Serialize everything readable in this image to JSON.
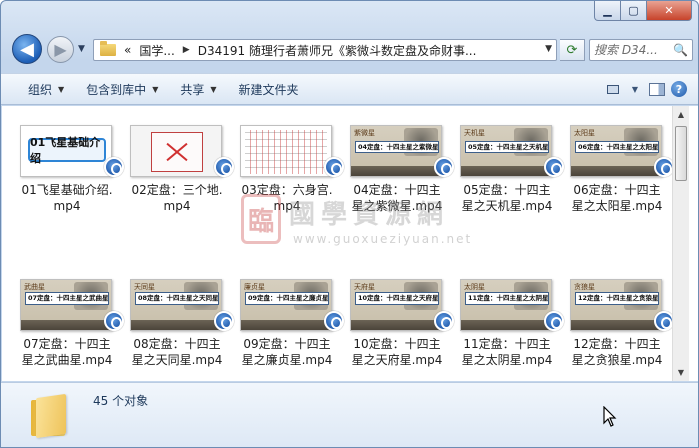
{
  "window": {
    "controls": {
      "minimize": "▁",
      "maximize": "▢",
      "close": "✕"
    }
  },
  "nav": {
    "back_icon": "◀",
    "forward_icon": "▶",
    "recent_icon": "▼",
    "address": {
      "overflow": "«",
      "crumb1": "国学...",
      "sep": "▶",
      "crumb2": "D34191 随理行者萧师兄《紫微斗数定盘及命财事...",
      "dropdown": "▼"
    },
    "refresh_icon": "⟳",
    "search_placeholder": "搜索 D34...",
    "search_icon": "🔍"
  },
  "toolbar": {
    "organize": "组织",
    "include_in_library": "包含到库中",
    "share": "共享",
    "new_folder": "新建文件夹",
    "dropdown_arrow": "▼",
    "view_icon": "view-icon",
    "help": "?"
  },
  "files": [
    {
      "name": "01飞星基础介绍.mp4",
      "line1": "01飞星基础介绍.",
      "line2": "mp4",
      "thumb_title": "01飞星基础介绍"
    },
    {
      "name": "02定盘：三个地.mp4",
      "line1": "02定盘：三个地.",
      "line2": "mp4"
    },
    {
      "name": "03定盘：六身宫.mp4",
      "line1": "03定盘：六身宫.",
      "line2": "mp4"
    },
    {
      "name": "04定盘：十四主星之紫微星.mp4",
      "line1": "04定盘：十四主",
      "line2": "星之紫微星.mp4",
      "thumb_tag": "紫微星",
      "thumb_bar": "04定盘：十四主星之紫微星"
    },
    {
      "name": "05定盘：十四主星之天机星.mp4",
      "line1": "05定盘：十四主",
      "line2": "星之天机星.mp4",
      "thumb_tag": "天机星",
      "thumb_bar": "05定盘：十四主星之天机星"
    },
    {
      "name": "06定盘：十四主星之太阳星.mp4",
      "line1": "06定盘：十四主",
      "line2": "星之太阳星.mp4",
      "thumb_tag": "太阳星",
      "thumb_bar": "06定盘：十四主星之太阳星"
    },
    {
      "name": "07定盘：十四主星之武曲星.mp4",
      "line1": "07定盘：十四主",
      "line2": "星之武曲星.mp4",
      "thumb_tag": "武曲星",
      "thumb_bar": "07定盘：十四主星之武曲星"
    },
    {
      "name": "08定盘：十四主星之天同星.mp4",
      "line1": "08定盘：十四主",
      "line2": "星之天同星.mp4",
      "thumb_tag": "天同星",
      "thumb_bar": "08定盘：十四主星之天同星"
    },
    {
      "name": "09定盘：十四主星之廉贞星.mp4",
      "line1": "09定盘：十四主",
      "line2": "星之廉贞星.mp4",
      "thumb_tag": "廉贞星",
      "thumb_bar": "09定盘：十四主星之廉贞星"
    },
    {
      "name": "10定盘：十四主星之天府星.mp4",
      "line1": "10定盘：十四主",
      "line2": "星之天府星.mp4",
      "thumb_tag": "天府星",
      "thumb_bar": "10定盘：十四主星之天府星"
    },
    {
      "name": "11定盘：十四主星之太阴星.mp4",
      "line1": "11定盘：十四主",
      "line2": "星之太阴星.mp4",
      "thumb_tag": "太阴星",
      "thumb_bar": "11定盘：十四主星之太阴星"
    },
    {
      "name": "12定盘：十四主星之贪狼星.mp4",
      "line1": "12定盘：十四主",
      "line2": "星之贪狼星.mp4",
      "thumb_tag": "贪狼星",
      "thumb_bar": "12定盘：十四主星之贪狼星"
    }
  ],
  "watermark": {
    "seal": "臨",
    "text": "國學資源網",
    "url": "www.guoxueziyuan.net"
  },
  "details": {
    "count": "45 个对象"
  },
  "scrollbar": {
    "up": "▲",
    "down": "▼"
  },
  "colors": {
    "accent": "#1c56a8",
    "command_text": "#1e395b",
    "close_button": "#c7432b"
  }
}
